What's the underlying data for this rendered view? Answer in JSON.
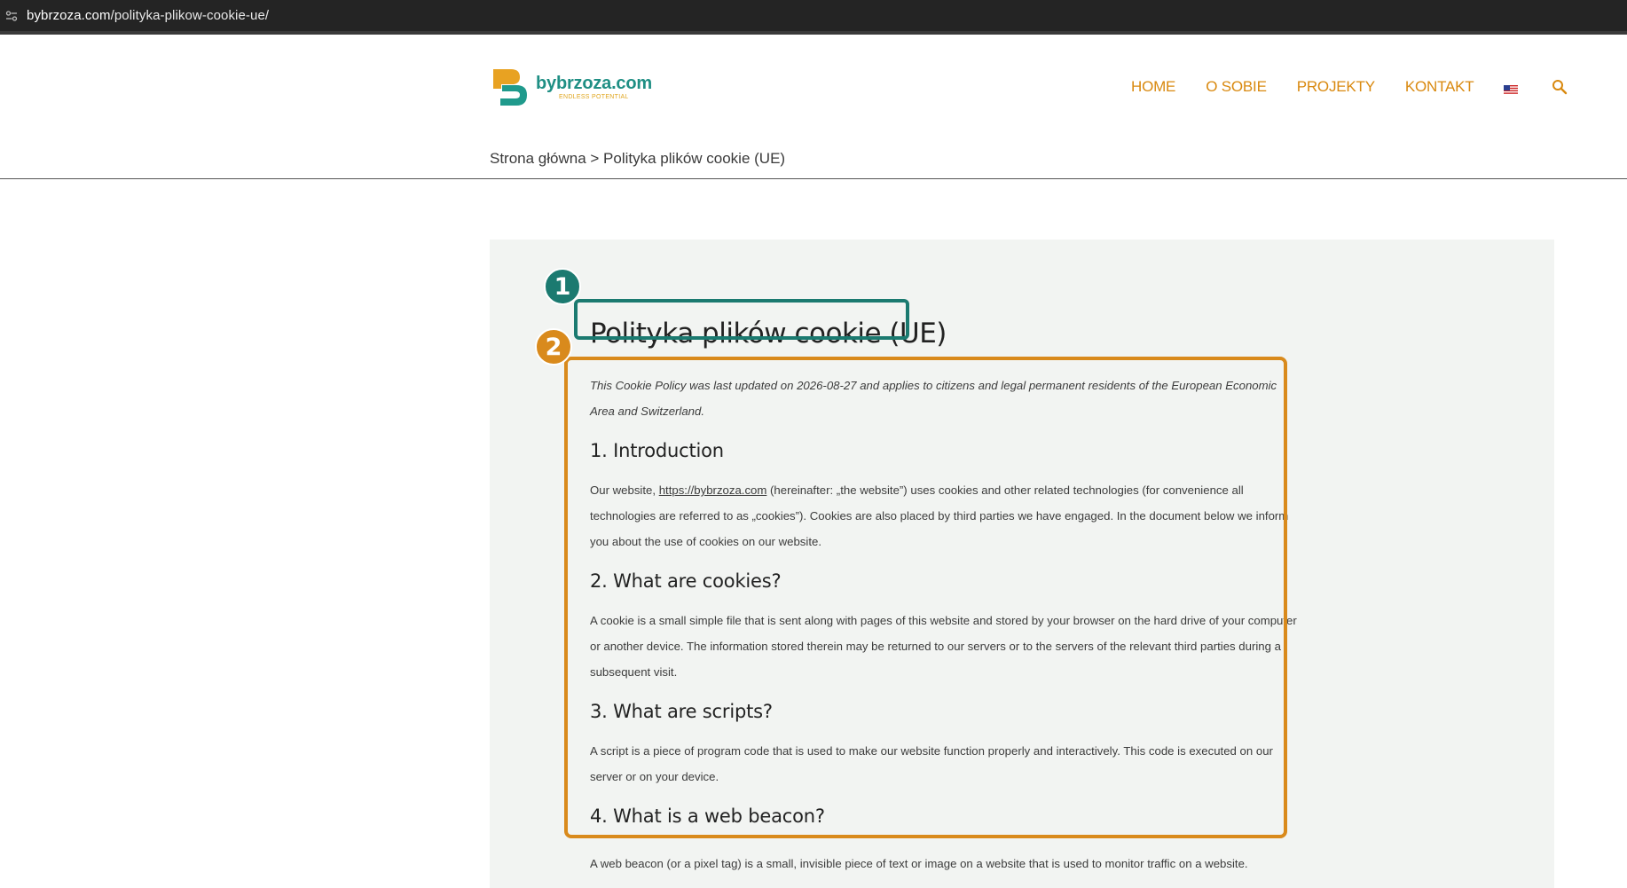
{
  "browser": {
    "url_domain": "bybrzoza.com",
    "url_path": "/polityka-plikow-cookie-ue/"
  },
  "header": {
    "logo_name": "bybrzoza.com",
    "logo_tagline": "ENDLESS POTENTIAL",
    "nav": [
      "HOME",
      "O SOBIE",
      "PROJEKTY",
      "KONTAKT"
    ],
    "accent_color": "#d9890f",
    "brand_color": "#1f8f84"
  },
  "breadcrumb": "Strona główna > Polityka plików cookie (UE)",
  "page": {
    "title": "Polityka plików cookie (UE)",
    "meta": "This Cookie Policy was last updated on 2026-08-27 and applies to citizens and legal permanent residents of the European Economic Area and Switzerland.",
    "sections": [
      {
        "heading": "1. Introduction",
        "text_before_link": "Our website, ",
        "link": "https://bybrzoza.com",
        "text_after_link": " (hereinafter: „the website”) uses cookies and other related technologies (for convenience all technologies are referred to as „cookies”). Cookies are also placed by third parties we have engaged. In the document below we inform you about the use of cookies on our website."
      },
      {
        "heading": "2. What are cookies?",
        "text": "A cookie is a small simple file that is sent along with pages of this website and stored by your browser on the hard drive of your computer or another device. The information stored therein may be returned to our servers or to the servers of the relevant third parties during a subsequent visit."
      },
      {
        "heading": "3. What are scripts?",
        "text": "A script is a piece of program code that is used to make our website function properly and interactively. This code is executed on our server or on your device."
      },
      {
        "heading": "4. What is a web beacon?",
        "text": "A web beacon (or a pixel tag) is a small, invisible piece of text or image on a website that is used to monitor traffic on a website."
      }
    ]
  },
  "annotations": {
    "badge1": "1",
    "badge2": "2",
    "color1": "#1b7a70",
    "color2": "#d98a1c"
  }
}
